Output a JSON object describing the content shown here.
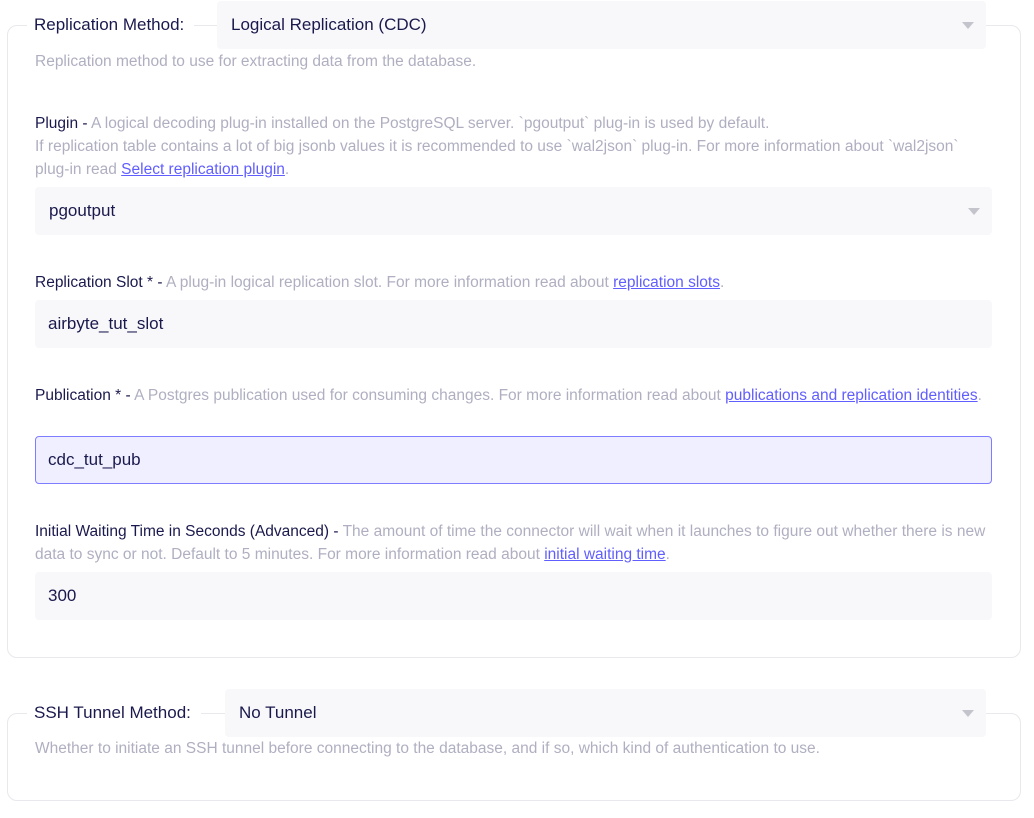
{
  "replication": {
    "legend_label": "Replication Method:",
    "method_value": "Logical Replication (CDC)",
    "method_hint": "Replication method to use for extracting data from the database.",
    "plugin": {
      "label": "Plugin",
      "sep": " - ",
      "desc_line1": "A logical decoding plug-in installed on the PostgreSQL server. `pgoutput` plug-in is used by default.",
      "desc_line2": "If replication table contains a lot of big jsonb values it is recommended to use `wal2json` plug-in. For more information about `wal2json` plug-in read",
      "link": "Select replication plugin",
      "end": ".",
      "value": "pgoutput"
    },
    "slot": {
      "label": "Replication Slot *",
      "sep": " - ",
      "desc": "A plug-in logical replication slot. For more information read about",
      "link": "replication slots",
      "end": ".",
      "value": "airbyte_tut_slot"
    },
    "publication": {
      "label": "Publication *",
      "sep": " - ",
      "desc": "A Postgres publication used for consuming changes. For more information read about",
      "link": "publications and replication identities",
      "end": ".",
      "value": "cdc_tut_pub"
    },
    "waiting": {
      "label": "Initial Waiting Time in Seconds (Advanced)",
      "sep": " - ",
      "desc": "The amount of time the connector will wait when it launches to figure out whether there is new data to sync or not. Default to 5 minutes. For more information read about",
      "link": "initial waiting time",
      "end": ".",
      "value": "300"
    }
  },
  "ssh": {
    "legend_label": "SSH Tunnel Method:",
    "method_value": "No Tunnel",
    "method_hint": "Whether to initiate an SSH tunnel before connecting to the database, and if so, which kind of authentication to use."
  },
  "colors": {
    "text": "#1a194d",
    "hint": "#afafc1",
    "link": "#615eff",
    "focus_border": "#7f7dff",
    "input_bg": "#f8f8fa"
  }
}
